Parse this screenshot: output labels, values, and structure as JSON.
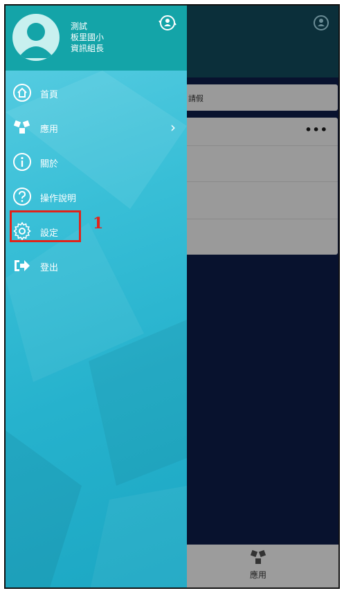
{
  "drawer": {
    "user": {
      "name": "測試",
      "school": "板里國小",
      "role": "資訊組長"
    },
    "menu": [
      {
        "label": "首頁",
        "icon": "home-icon"
      },
      {
        "label": "應用",
        "icon": "apps-icon"
      },
      {
        "label": "關於",
        "icon": "info-icon"
      },
      {
        "label": "操作說明",
        "icon": "help-icon"
      },
      {
        "label": "設定",
        "icon": "gear-icon"
      },
      {
        "label": "登出",
        "icon": "logout-icon"
      }
    ],
    "annotation": "1"
  },
  "background": {
    "card1_text": "請假",
    "card2_more": "•••",
    "footer_tab_label": "應用"
  },
  "colors": {
    "drawer_header": "#14a4a8",
    "drawer_body": "#26b2cd",
    "annotation_red": "#e2231a",
    "app_background": "#08122e"
  }
}
